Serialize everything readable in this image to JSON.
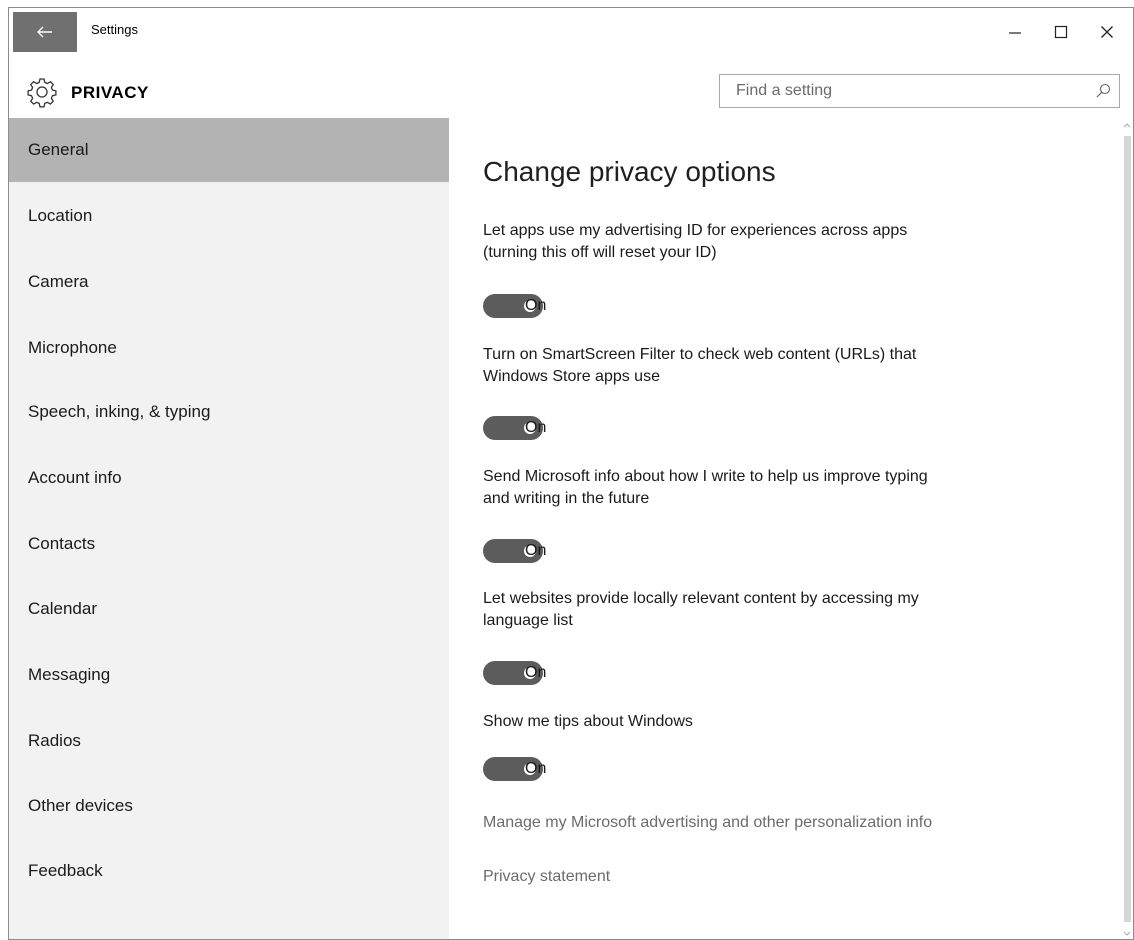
{
  "window": {
    "title": "Settings"
  },
  "header": {
    "heading": "PRIVACY",
    "search_placeholder": "Find a setting"
  },
  "sidebar": {
    "items": [
      {
        "label": "General",
        "selected": true
      },
      {
        "label": "Location"
      },
      {
        "label": "Camera"
      },
      {
        "label": "Microphone"
      },
      {
        "label": "Speech, inking, & typing"
      },
      {
        "label": "Account info"
      },
      {
        "label": "Contacts"
      },
      {
        "label": "Calendar"
      },
      {
        "label": "Messaging"
      },
      {
        "label": "Radios"
      },
      {
        "label": "Other devices"
      },
      {
        "label": "Feedback"
      }
    ]
  },
  "content": {
    "title": "Change privacy options",
    "settings": [
      {
        "line1": "Let apps use my advertising ID for experiences across apps",
        "line2": "(turning this off will reset your ID)",
        "state": "On"
      },
      {
        "line1": "Turn on SmartScreen Filter to check web content (URLs) that",
        "line2": "Windows Store apps use",
        "state": "On"
      },
      {
        "line1": "Send Microsoft info about how I write to help us improve typing",
        "line2": "and writing in the future",
        "state": "On"
      },
      {
        "line1": "Let websites provide locally relevant content by accessing my",
        "line2": "language list",
        "state": "On"
      },
      {
        "line1": "Show me tips about Windows",
        "state": "On"
      }
    ],
    "links": {
      "manage": "Manage my Microsoft advertising and other personalization info",
      "privacy": "Privacy statement"
    }
  },
  "colors": {
    "selected_nav": "#b3b3b3",
    "sidebar_bg": "#f2f2f2",
    "toggle_on": "#5c5c5c",
    "link": "#6b6b6b"
  },
  "icons": [
    "back-arrow-icon",
    "minimize-icon",
    "maximize-icon",
    "close-icon",
    "gear-icon",
    "search-icon"
  ]
}
